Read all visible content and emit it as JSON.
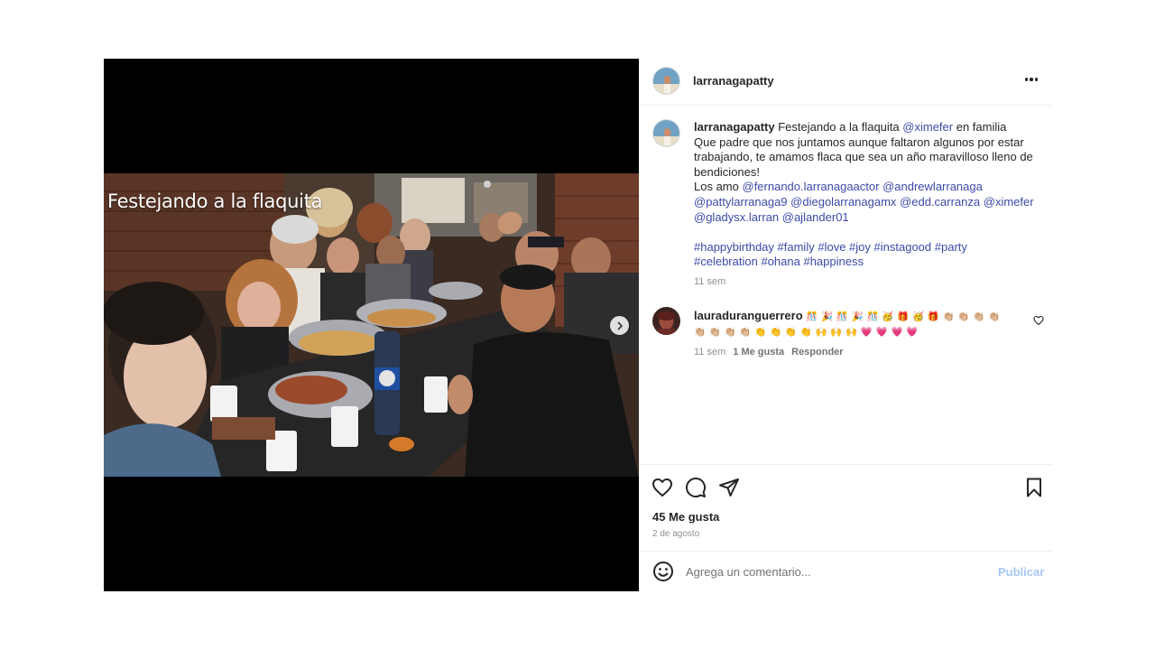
{
  "post": {
    "overlay_text": "Festejando a la flaquita",
    "author": "larranagapatty"
  },
  "caption": {
    "username": "larranagapatty",
    "text_prefix": "Festejando a la flaquita",
    "mention_1": "@ximefer",
    "text_suffix": "en familia",
    "line2": "Que padre que nos juntamos aunque faltaron algunos por estar",
    "line3": "trabajando, te amamos flaca que sea un año maravilloso lleno de",
    "line4": "bendiciones!",
    "line5_prefix": "Los amo",
    "mentions_a": [
      "@fernando.larranagaactor",
      "@andrewlarranaga"
    ],
    "mentions_b": [
      "@pattylarranaga9",
      "@diegolarranagamx",
      "@edd.carranza",
      "@ximefer"
    ],
    "mentions_c": [
      "@gladysx.larran",
      "@ajlander01"
    ],
    "hashtags_1": [
      "#happybirthday",
      "#family",
      "#love",
      "#joy",
      "#instagood",
      "#party"
    ],
    "hashtags_2": [
      "#celebration",
      "#ohana",
      "#happiness"
    ],
    "time": "11 sem"
  },
  "comment": {
    "username": "lauraduranguerrero",
    "emoji_line1": "🎊 🎉 🎊 🎉 🎊 🥳 🎁 🥳 🎁 👏🏼 👏🏼 👏🏼 👏🏼",
    "emoji_line2": "👏🏼 👏🏼 👏🏼 👏🏼 👏 👏 👏 👏 🙌 🙌 🙌 💗 💗 💗 💗",
    "time": "11 sem",
    "likes": "1 Me gusta",
    "reply": "Responder"
  },
  "actions": {
    "likes_count": "45 Me gusta",
    "date": "2 de agosto"
  },
  "add_comment": {
    "placeholder": "Agrega un comentario...",
    "publish": "Publicar"
  },
  "colors": {
    "link": "#3c4aa8",
    "publish_disabled": "#a8c7f5",
    "secondary_text": "#8e8e8e",
    "heart_comment": "#e0245e"
  }
}
